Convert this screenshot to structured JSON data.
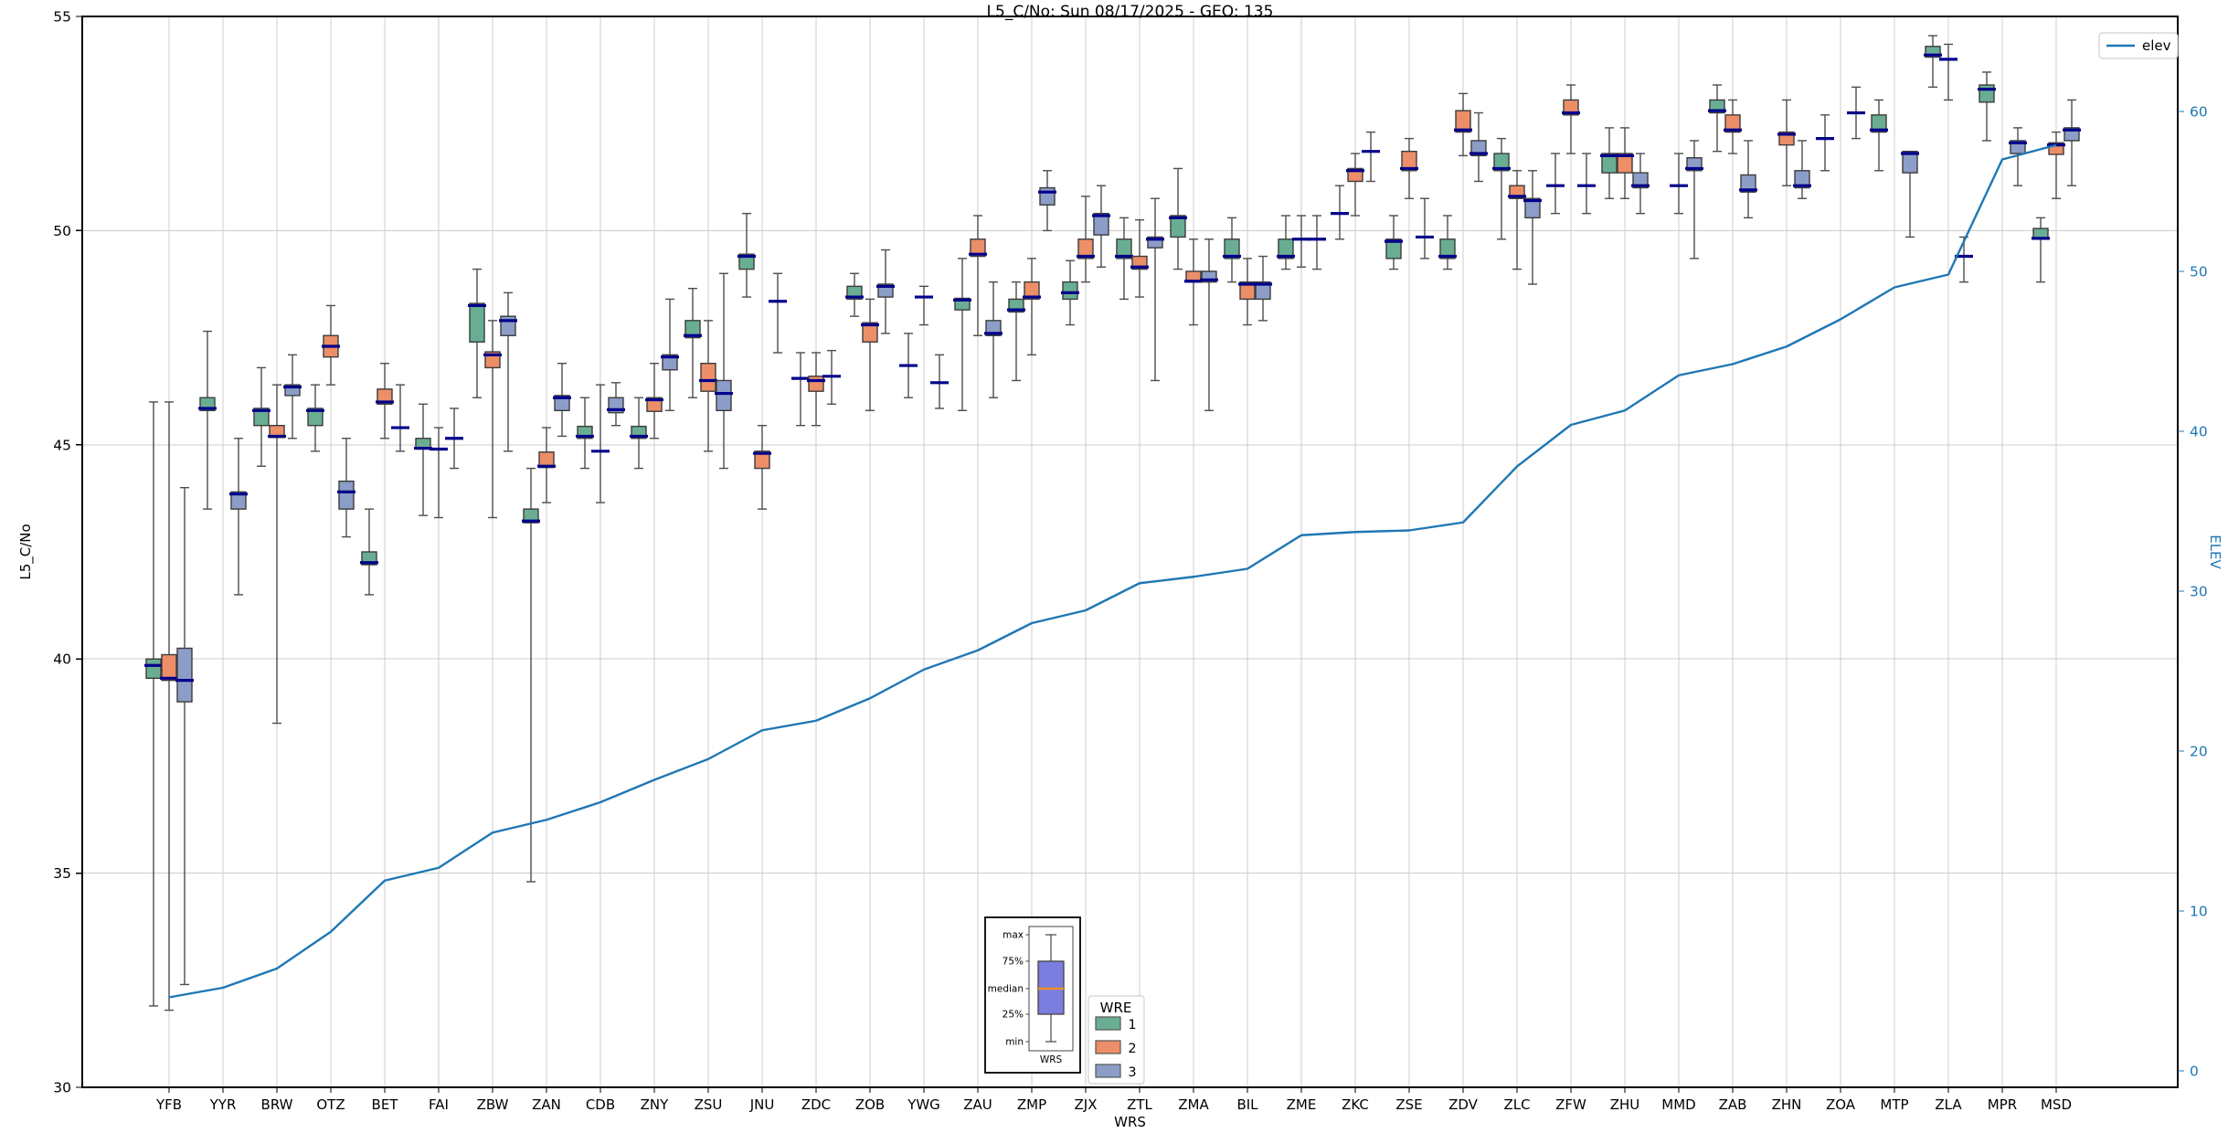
{
  "chart_data": {
    "type": "boxplot+line",
    "title": "L5_C/No: Sun 08/17/2025 - GEO: 135",
    "xlabel": "WRS",
    "ylabel_left": "L5_C/No",
    "ylabel_right": "ELEV",
    "ylim_left": [
      30,
      55
    ],
    "yticks_left": [
      30,
      35,
      40,
      45,
      50,
      55
    ],
    "yticks_right": [
      0,
      10,
      20,
      30,
      40,
      50,
      60
    ],
    "grid": true,
    "colors": {
      "median": "#00008b",
      "whisker": "#4d4d4d",
      "box_edge": "#3c3c3c",
      "grid": "#cccccc",
      "elev_line": "#1f77b4",
      "right_axis_text": "#1f77b4"
    },
    "line_legend": {
      "label": "elev",
      "color": "#1f77b4"
    },
    "wre_legend": {
      "title": "WRE",
      "entries": [
        {
          "label": "1",
          "color": "#69ae92"
        },
        {
          "label": "2",
          "color": "#ec8e68"
        },
        {
          "label": "3",
          "color": "#8c9dc7"
        }
      ]
    },
    "inset_legend": {
      "labels": [
        "max",
        "75%",
        "median",
        "25%",
        "min"
      ],
      "xlabel": "WRS",
      "box_color": "#7b7ede",
      "median_color": "#ff8c1a"
    },
    "categories": [
      "YFB",
      "YYR",
      "BRW",
      "OTZ",
      "BET",
      "FAI",
      "ZBW",
      "ZAN",
      "CDB",
      "ZNY",
      "ZSU",
      "JNU",
      "ZDC",
      "ZOB",
      "YWG",
      "ZAU",
      "ZMP",
      "ZJX",
      "ZTL",
      "ZMA",
      "BIL",
      "ZME",
      "ZKC",
      "ZSE",
      "ZDV",
      "ZLC",
      "ZFW",
      "ZHU",
      "MMD",
      "ZAB",
      "ZHN",
      "ZOA",
      "MTP",
      "ZLA",
      "MPR",
      "MSD"
    ],
    "elev": [
      4.6,
      5.2,
      6.4,
      8.7,
      11.9,
      12.7,
      14.9,
      15.7,
      16.8,
      18.2,
      19.5,
      21.3,
      21.9,
      23.3,
      25.1,
      26.3,
      28.0,
      28.8,
      30.5,
      30.9,
      31.4,
      33.5,
      33.7,
      33.8,
      34.3,
      37.8,
      40.4,
      41.3,
      43.5,
      44.2,
      45.3,
      47.0,
      49.0,
      49.8,
      57.0,
      57.9
    ],
    "series": [
      {
        "name": "1",
        "color": "#69ae92",
        "boxes": [
          [
            31.9,
            39.55,
            39.85,
            40.0,
            46.0
          ],
          [
            43.5,
            45.8,
            45.85,
            46.1,
            47.65
          ],
          [
            44.5,
            45.45,
            45.8,
            45.85,
            46.8
          ],
          [
            44.85,
            45.45,
            45.8,
            45.85,
            46.4
          ],
          [
            41.5,
            42.2,
            42.25,
            42.5,
            43.5
          ],
          [
            43.35,
            44.9,
            44.92,
            45.15,
            45.95
          ],
          [
            46.1,
            47.4,
            48.25,
            48.3,
            49.1
          ],
          [
            34.8,
            43.18,
            43.22,
            43.5,
            44.45
          ],
          [
            44.45,
            45.15,
            45.2,
            45.43,
            46.1
          ],
          [
            44.45,
            45.15,
            45.2,
            45.43,
            46.1
          ],
          [
            46.1,
            47.5,
            47.55,
            47.9,
            48.65
          ],
          [
            48.45,
            49.1,
            49.4,
            49.45,
            50.4
          ],
          [
            45.45,
            46.55,
            46.55,
            46.55,
            47.15
          ],
          [
            48.0,
            48.4,
            48.45,
            48.7,
            49.0
          ],
          [
            46.1,
            46.85,
            46.85,
            46.85,
            47.6
          ],
          [
            45.8,
            48.15,
            48.38,
            48.42,
            49.35
          ],
          [
            46.5,
            48.1,
            48.15,
            48.4,
            48.8
          ],
          [
            47.8,
            48.4,
            48.55,
            48.8,
            49.3
          ],
          [
            48.4,
            49.35,
            49.4,
            49.8,
            50.3
          ],
          [
            49.1,
            49.85,
            50.3,
            50.35,
            51.45
          ],
          [
            48.8,
            49.35,
            49.4,
            49.8,
            50.3
          ],
          [
            49.1,
            49.35,
            49.4,
            49.8,
            50.35
          ],
          [
            49.8,
            50.4,
            50.4,
            50.4,
            51.05
          ],
          [
            49.1,
            49.35,
            49.75,
            49.8,
            50.35
          ],
          [
            49.1,
            49.35,
            49.4,
            49.8,
            50.35
          ],
          [
            49.8,
            51.4,
            51.45,
            51.8,
            52.15
          ],
          [
            50.4,
            51.05,
            51.05,
            51.05,
            51.8
          ],
          [
            50.75,
            51.35,
            51.75,
            51.8,
            52.4
          ],
          null,
          [
            51.85,
            52.75,
            52.8,
            53.05,
            53.4
          ],
          null,
          [
            51.4,
            52.15,
            52.15,
            52.15,
            52.7
          ],
          [
            51.4,
            52.3,
            52.35,
            52.7,
            53.05
          ],
          [
            53.35,
            54.05,
            54.1,
            54.3,
            54.55
          ],
          [
            52.1,
            53.0,
            53.3,
            53.4,
            53.7
          ],
          [
            48.8,
            49.8,
            49.82,
            50.05,
            50.3
          ]
        ]
      },
      {
        "name": "2",
        "color": "#ec8e68",
        "boxes": [
          [
            31.8,
            39.5,
            39.55,
            40.1,
            46.0
          ],
          null,
          [
            38.5,
            45.17,
            45.2,
            45.45,
            46.4
          ],
          [
            46.4,
            47.05,
            47.3,
            47.55,
            48.25
          ],
          [
            45.15,
            45.95,
            46.0,
            46.3,
            46.9
          ],
          [
            43.3,
            44.9,
            44.9,
            44.9,
            45.4
          ],
          [
            43.3,
            46.8,
            47.1,
            47.17,
            47.9
          ],
          [
            43.65,
            44.47,
            44.5,
            44.83,
            45.4
          ],
          [
            43.65,
            44.85,
            44.85,
            44.85,
            46.4
          ],
          [
            45.15,
            45.78,
            46.05,
            46.1,
            46.9
          ],
          [
            44.85,
            46.25,
            46.5,
            46.9,
            47.9
          ],
          [
            43.5,
            44.45,
            44.8,
            44.85,
            45.45
          ],
          [
            45.45,
            46.25,
            46.5,
            46.6,
            47.15
          ],
          [
            45.8,
            47.4,
            47.8,
            47.85,
            48.4
          ],
          [
            47.8,
            48.45,
            48.45,
            48.45,
            48.7
          ],
          [
            47.55,
            49.4,
            49.45,
            49.8,
            50.35
          ],
          [
            47.1,
            48.4,
            48.45,
            48.8,
            49.35
          ],
          [
            48.8,
            49.35,
            49.4,
            49.8,
            50.8
          ],
          [
            48.45,
            49.1,
            49.15,
            49.4,
            50.25
          ],
          [
            47.8,
            48.8,
            48.82,
            49.05,
            49.8
          ],
          [
            47.8,
            48.4,
            48.75,
            48.8,
            49.35
          ],
          [
            49.15,
            49.8,
            49.8,
            49.8,
            50.35
          ],
          [
            50.35,
            51.15,
            51.4,
            51.45,
            51.8
          ],
          [
            50.75,
            51.4,
            51.45,
            51.85,
            52.15
          ],
          [
            51.75,
            52.3,
            52.35,
            52.8,
            53.2
          ],
          [
            49.1,
            50.75,
            50.8,
            51.05,
            51.4
          ],
          [
            51.8,
            52.7,
            52.75,
            53.05,
            53.4
          ],
          [
            50.75,
            51.35,
            51.75,
            51.8,
            52.4
          ],
          [
            50.4,
            51.05,
            51.05,
            51.05,
            51.8
          ],
          [
            51.8,
            52.3,
            52.35,
            52.7,
            53.05
          ],
          [
            51.05,
            52.0,
            52.25,
            52.3,
            53.05
          ],
          null,
          null,
          [
            53.05,
            54.0,
            54.0,
            54.0,
            54.35
          ],
          null,
          [
            50.75,
            51.78,
            52.0,
            52.05,
            52.3
          ]
        ]
      },
      {
        "name": "3",
        "color": "#8c9dc7",
        "boxes": [
          [
            32.4,
            39.0,
            39.5,
            40.25,
            44.0
          ],
          [
            41.5,
            43.5,
            43.85,
            43.9,
            45.15
          ],
          [
            45.15,
            46.15,
            46.35,
            46.4,
            47.1
          ],
          [
            42.85,
            43.5,
            43.9,
            44.15,
            45.15
          ],
          [
            44.85,
            45.4,
            45.4,
            45.4,
            46.4
          ],
          [
            44.45,
            45.15,
            45.15,
            45.15,
            45.85
          ],
          [
            44.85,
            47.55,
            47.9,
            48.0,
            48.55
          ],
          [
            45.2,
            45.8,
            46.1,
            46.15,
            46.9
          ],
          [
            45.45,
            45.75,
            45.82,
            46.1,
            46.45
          ],
          [
            45.8,
            46.75,
            47.05,
            47.1,
            48.4
          ],
          [
            44.45,
            45.8,
            46.2,
            46.5,
            49.0
          ],
          [
            47.15,
            48.35,
            48.35,
            48.35,
            49.0
          ],
          [
            45.95,
            46.6,
            46.6,
            46.6,
            47.2
          ],
          [
            47.6,
            48.45,
            48.7,
            48.75,
            49.55
          ],
          [
            45.85,
            46.45,
            46.45,
            46.45,
            47.1
          ],
          [
            46.1,
            47.55,
            47.6,
            47.9,
            48.8
          ],
          [
            50.0,
            50.6,
            50.9,
            51.0,
            51.4
          ],
          [
            49.15,
            49.9,
            50.35,
            50.4,
            51.05
          ],
          [
            46.5,
            49.6,
            49.8,
            49.85,
            50.75
          ],
          [
            45.8,
            48.8,
            48.85,
            49.05,
            49.8
          ],
          [
            47.9,
            48.4,
            48.75,
            48.8,
            49.4
          ],
          [
            49.1,
            49.8,
            49.8,
            49.8,
            50.35
          ],
          [
            51.15,
            51.85,
            51.85,
            51.85,
            52.3
          ],
          [
            49.35,
            49.85,
            49.85,
            49.85,
            50.75
          ],
          [
            51.15,
            51.75,
            51.8,
            52.1,
            52.75
          ],
          [
            48.75,
            50.3,
            50.7,
            50.75,
            51.4
          ],
          [
            50.4,
            51.05,
            51.05,
            51.05,
            51.8
          ],
          [
            50.4,
            51.0,
            51.05,
            51.35,
            51.8
          ],
          [
            49.35,
            51.4,
            51.45,
            51.7,
            52.1
          ],
          [
            50.3,
            50.9,
            50.95,
            51.3,
            52.1
          ],
          [
            50.75,
            51.0,
            51.05,
            51.4,
            52.1
          ],
          [
            52.15,
            52.75,
            52.75,
            52.75,
            53.35
          ],
          [
            49.85,
            51.35,
            51.8,
            51.85,
            51.85
          ],
          [
            48.8,
            49.4,
            49.4,
            49.4,
            49.85
          ],
          [
            51.05,
            51.8,
            52.05,
            52.1,
            52.4
          ],
          [
            51.05,
            52.1,
            52.35,
            52.4,
            53.05
          ]
        ]
      }
    ]
  }
}
